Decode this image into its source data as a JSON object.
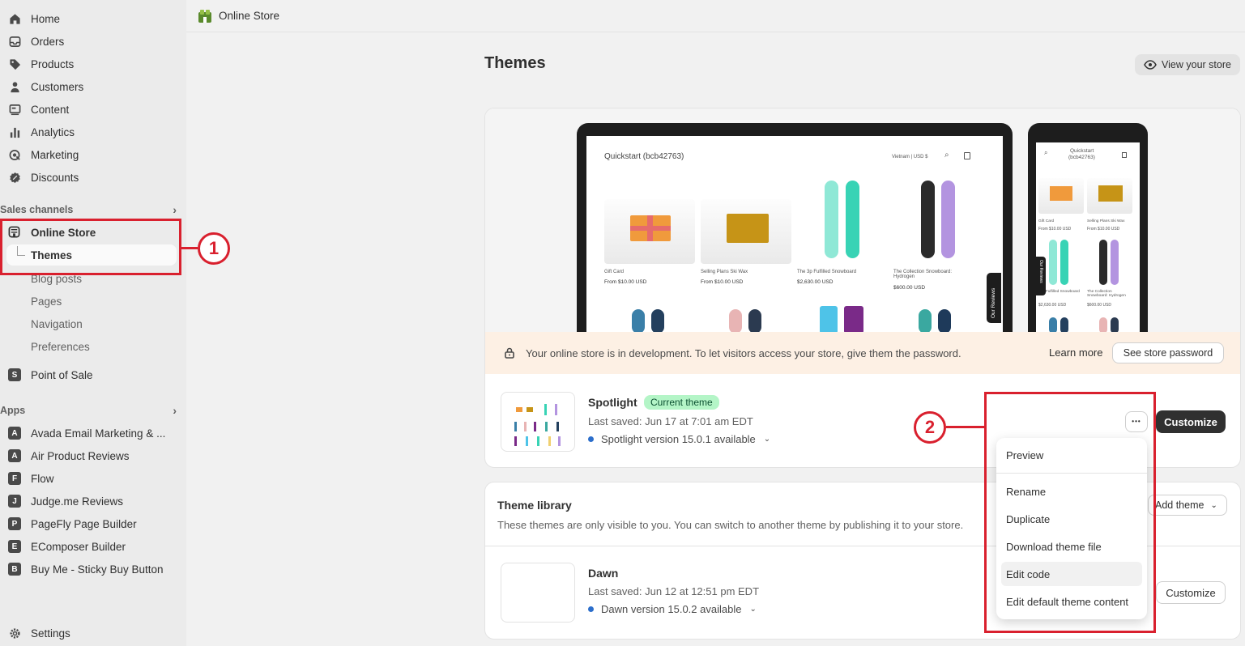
{
  "sidebar": {
    "main_items": [
      {
        "label": "Home",
        "icon": "home-icon"
      },
      {
        "label": "Orders",
        "icon": "inbox-icon"
      },
      {
        "label": "Products",
        "icon": "tag-icon"
      },
      {
        "label": "Customers",
        "icon": "person-icon"
      },
      {
        "label": "Content",
        "icon": "content-icon"
      },
      {
        "label": "Analytics",
        "icon": "bar-chart-icon"
      },
      {
        "label": "Marketing",
        "icon": "target-icon"
      },
      {
        "label": "Discounts",
        "icon": "discount-icon"
      }
    ],
    "sales_channels_label": "Sales channels",
    "online_store_label": "Online Store",
    "themes_label": "Themes",
    "online_store_subitems": [
      "Blog posts",
      "Pages",
      "Navigation",
      "Preferences"
    ],
    "point_of_sale_label": "Point of Sale",
    "apps_label": "Apps",
    "apps": [
      {
        "label": "Avada Email Marketing & ...",
        "icon_letter": "A"
      },
      {
        "label": "Air Product Reviews",
        "icon_letter": "A"
      },
      {
        "label": "Flow",
        "icon_letter": "F"
      },
      {
        "label": "Judge.me Reviews",
        "icon_letter": "J"
      },
      {
        "label": "PageFly Page Builder",
        "icon_letter": "P"
      },
      {
        "label": "EComposer Builder",
        "icon_letter": "E"
      },
      {
        "label": "Buy Me - Sticky Buy Button",
        "icon_letter": "B"
      }
    ],
    "settings_label": "Settings"
  },
  "topbar": {
    "title": "Online Store"
  },
  "page": {
    "title": "Themes",
    "view_store_label": "View your store"
  },
  "preview": {
    "store_name": "Quickstart (bcb42763)",
    "phone_store_name_line1": "Quickstart",
    "phone_store_name_line2": "(bcb42763)",
    "locale": "Vietnam | USD $",
    "reviews_tab": "Our Reviews",
    "products": [
      {
        "name": "Gift Card",
        "price": "From $10.00 USD"
      },
      {
        "name": "Selling Plans Ski Wax",
        "price": "From $10.00 USD"
      },
      {
        "name": "The 3p Fulfilled Snowboard",
        "price": "$2,630.00 USD"
      },
      {
        "name": "The Collection Snowboard: Hydrogen",
        "price": "$600.00 USD"
      }
    ],
    "phone_products": [
      {
        "name": "Gift Card",
        "price": "From $10.00 USD"
      },
      {
        "name": "Selling Plans Ski Wax",
        "price": "From $10.00 USD"
      },
      {
        "name": "...ly Fulfilled Snowboard",
        "price": "$2,630.00 USD"
      },
      {
        "name": "The Collection Snowboard: Hydrogen",
        "price": "$600.00 USD"
      }
    ]
  },
  "dev_banner": {
    "message": "Your online store is in development. To let visitors access your store, give them the password.",
    "learn_more": "Learn more",
    "see_password": "See store password"
  },
  "current_theme": {
    "name": "Spotlight",
    "badge": "Current theme",
    "last_saved": "Last saved: Jun 17 at 7:01 am EDT",
    "version": "Spotlight version 15.0.1 available",
    "more_label": "•••",
    "customize_label": "Customize"
  },
  "library": {
    "title": "Theme library",
    "description": "These themes are only visible to you. You can switch to another theme by publishing it to your store.",
    "add_theme_label": "Add theme",
    "themes": [
      {
        "name": "Dawn",
        "last_saved": "Last saved: Jun 12 at 12:51 pm EDT",
        "version": "Dawn version 15.0.2 available",
        "customize_label": "Customize"
      }
    ]
  },
  "menu": {
    "items": [
      "Preview",
      "Rename",
      "Duplicate",
      "Download theme file",
      "Edit code",
      "Edit default theme content"
    ],
    "hovered": "Edit code"
  },
  "annotations": {
    "step1": "1",
    "step2": "2",
    "color": "#d9202e"
  }
}
